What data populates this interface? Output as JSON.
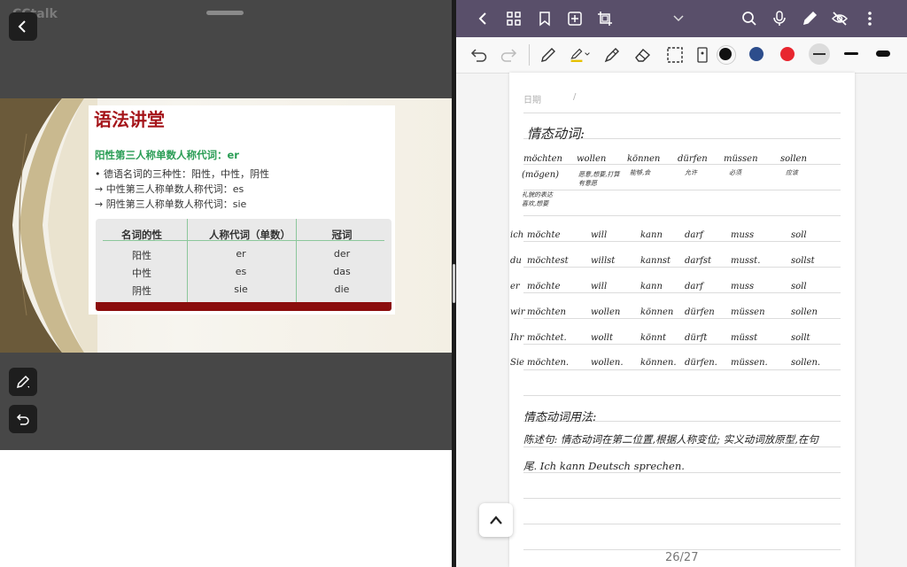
{
  "left_app": {
    "name": "CCtalk",
    "slide": {
      "title": "语法讲堂",
      "subtitle": "阳性第三人称单数人称代词：er",
      "bullets": [
        "• 德语名词的三种性：阳性，中性，阴性",
        "→ 中性第三人称单数人称代词：es",
        "→ 阴性第三人称单数人称代词：sie"
      ],
      "table": {
        "headers": [
          "名词的性",
          "人称代词（单数）",
          "冠词"
        ],
        "rows": [
          [
            "阳性",
            "er",
            "der"
          ],
          [
            "中性",
            "es",
            "das"
          ],
          [
            "阴性",
            "sie",
            "die"
          ]
        ]
      }
    },
    "icons": [
      "back-arrow-icon",
      "pencil-icon",
      "undo-icon"
    ]
  },
  "notes_app": {
    "topbar_icons": [
      "back-icon",
      "grid-icon",
      "bookmark-icon",
      "add-page-icon",
      "crop-icon",
      "chevron-down-icon",
      "search-icon",
      "mic-icon",
      "pen-icon",
      "eye-off-icon",
      "more-icon"
    ],
    "tools": [
      "undo-icon",
      "redo-icon",
      "pen-tool-icon",
      "highlighter-icon",
      "pencil-tool-icon",
      "eraser-icon",
      "lasso-icon",
      "image-tool-icon"
    ],
    "colors": [
      "#111111",
      "#2d4d8c",
      "#e8262f",
      "#9e9e9e"
    ],
    "page": {
      "date_label": "日期",
      "date_slash": "/",
      "heading": "情态动词:",
      "verbs": [
        "möchten",
        "wollen",
        "können",
        "dürfen",
        "müssen",
        "sollen"
      ],
      "verb_note_1": "(mögen)",
      "meanings": [
        "愿意,想要,打算",
        "能够,会",
        "允许",
        "必须",
        "应该"
      ],
      "meaning_extra": "有意愿",
      "side_note": [
        "礼貌的表达",
        "喜欢,想要"
      ],
      "conj_rows": [
        {
          "pronoun": "ich",
          "forms": [
            "möchte",
            "will",
            "kann",
            "darf",
            "muss",
            "soll"
          ]
        },
        {
          "pronoun": "du",
          "forms": [
            "möchtest",
            "willst",
            "kannst",
            "darfst",
            "musst.",
            "sollst"
          ]
        },
        {
          "pronoun": "er",
          "forms": [
            "möchte",
            "will",
            "kann",
            "darf",
            "muss",
            "soll"
          ]
        },
        {
          "pronoun": "wir",
          "forms": [
            "möchten",
            "wollen",
            "können",
            "dürfen",
            "müssen",
            "sollen"
          ]
        },
        {
          "pronoun": "Ihr",
          "forms": [
            "möchtet.",
            "wollt",
            "könnt",
            "dürft",
            "müsst",
            "sollt"
          ]
        },
        {
          "pronoun": "Sie",
          "forms": [
            "möchten.",
            "wollen.",
            "können.",
            "dürfen.",
            "müssen.",
            "sollen."
          ]
        }
      ],
      "usage_heading": "情态动词用法:",
      "usage_line1": "陈述句:  情态动词在第二位置,根据人称变位; 实义动词放原型,在句",
      "usage_line2": "尾.   Ich  kann  Deutsch  sprechen."
    },
    "page_number": "26/27"
  }
}
